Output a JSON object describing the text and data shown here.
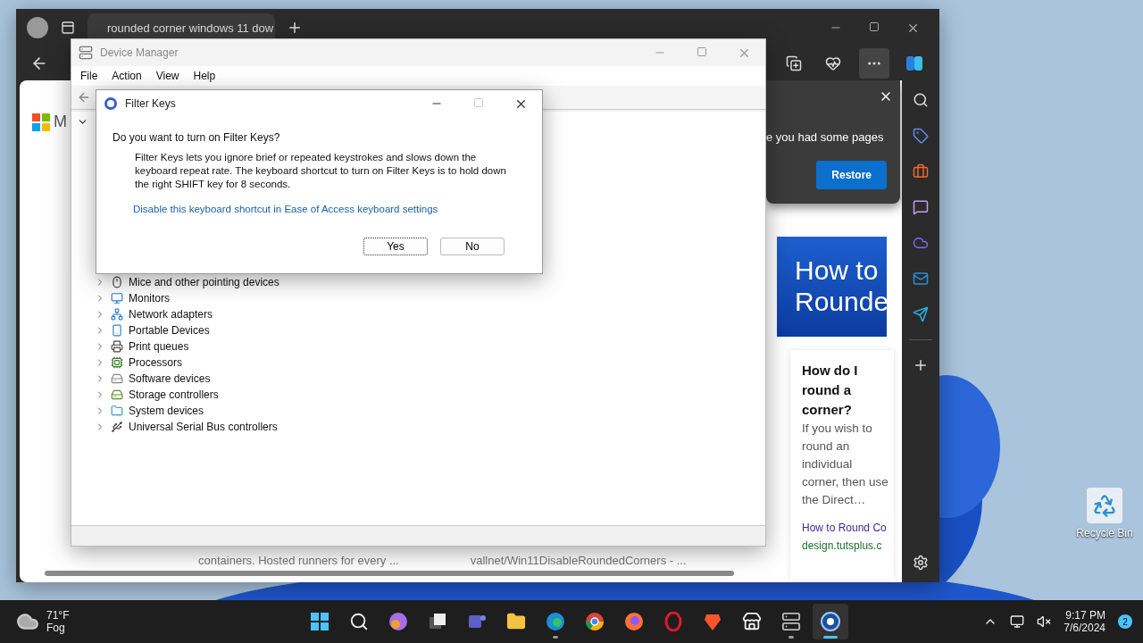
{
  "browser": {
    "tab": {
      "title": "rounded corner windows 11 dow",
      "selected": true
    },
    "restore_prompt": {
      "text": "e you had some pages",
      "button": "Restore"
    },
    "page": {
      "logo_text": "M",
      "banner_lines": [
        "How to",
        "Rounde"
      ],
      "result": {
        "title": "How do I round a corner?",
        "snippet": "If you wish to round an individual corner, then use the Direct…",
        "link": "How to Round Co",
        "url": "design.tutsplus.c"
      },
      "footer_texts": [
        "containers. Hosted runners for every ...",
        "vallnet/Win11DisableRoundedCorners - ..."
      ]
    }
  },
  "device_manager": {
    "title": "Device Manager",
    "menu": [
      "File",
      "Action",
      "View",
      "Help"
    ],
    "tree": [
      {
        "label": "Mice and other pointing devices",
        "expanded": false
      },
      {
        "label": "Monitors",
        "expanded": false
      },
      {
        "label": "Network adapters",
        "expanded": false
      },
      {
        "label": "Portable Devices",
        "expanded": false
      },
      {
        "label": "Print queues",
        "expanded": false
      },
      {
        "label": "Processors",
        "expanded": false
      },
      {
        "label": "Software devices",
        "expanded": false
      },
      {
        "label": "Storage controllers",
        "expanded": false
      },
      {
        "label": "System devices",
        "expanded": false
      },
      {
        "label": "Universal Serial Bus controllers",
        "expanded": false
      }
    ]
  },
  "dialog": {
    "title": "Filter Keys",
    "question": "Do you want to turn on Filter Keys?",
    "description": "Filter Keys lets you ignore brief or repeated keystrokes and slows down the keyboard repeat rate.  The keyboard shortcut to turn on Filter Keys is to hold down the right SHIFT key for 8 seconds.",
    "link": "Disable this keyboard shortcut in Ease of Access keyboard settings",
    "buttons": [
      {
        "label": "Yes",
        "focused": true
      },
      {
        "label": "No",
        "focused": false
      }
    ]
  },
  "desktop": {
    "icons": [
      {
        "label": "Recycle Bin"
      }
    ]
  },
  "taskbar": {
    "weather": {
      "temperature": "71°F",
      "condition": "Fog"
    },
    "apps": [
      {
        "running": false,
        "selected": false
      },
      {
        "running": false,
        "selected": false
      },
      {
        "running": false,
        "selected": false
      },
      {
        "running": false,
        "selected": false
      },
      {
        "running": false,
        "selected": false
      },
      {
        "running": false,
        "selected": false
      },
      {
        "running": true,
        "selected": false
      },
      {
        "running": false,
        "selected": false
      },
      {
        "running": false,
        "selected": false
      },
      {
        "running": false,
        "selected": false
      },
      {
        "running": false,
        "selected": false
      },
      {
        "running": false,
        "selected": false
      },
      {
        "running": true,
        "selected": false
      },
      {
        "running": true,
        "selected": true
      }
    ],
    "clock": {
      "time": "9:17 PM",
      "date": "7/6/2024"
    },
    "notifications": "2"
  }
}
